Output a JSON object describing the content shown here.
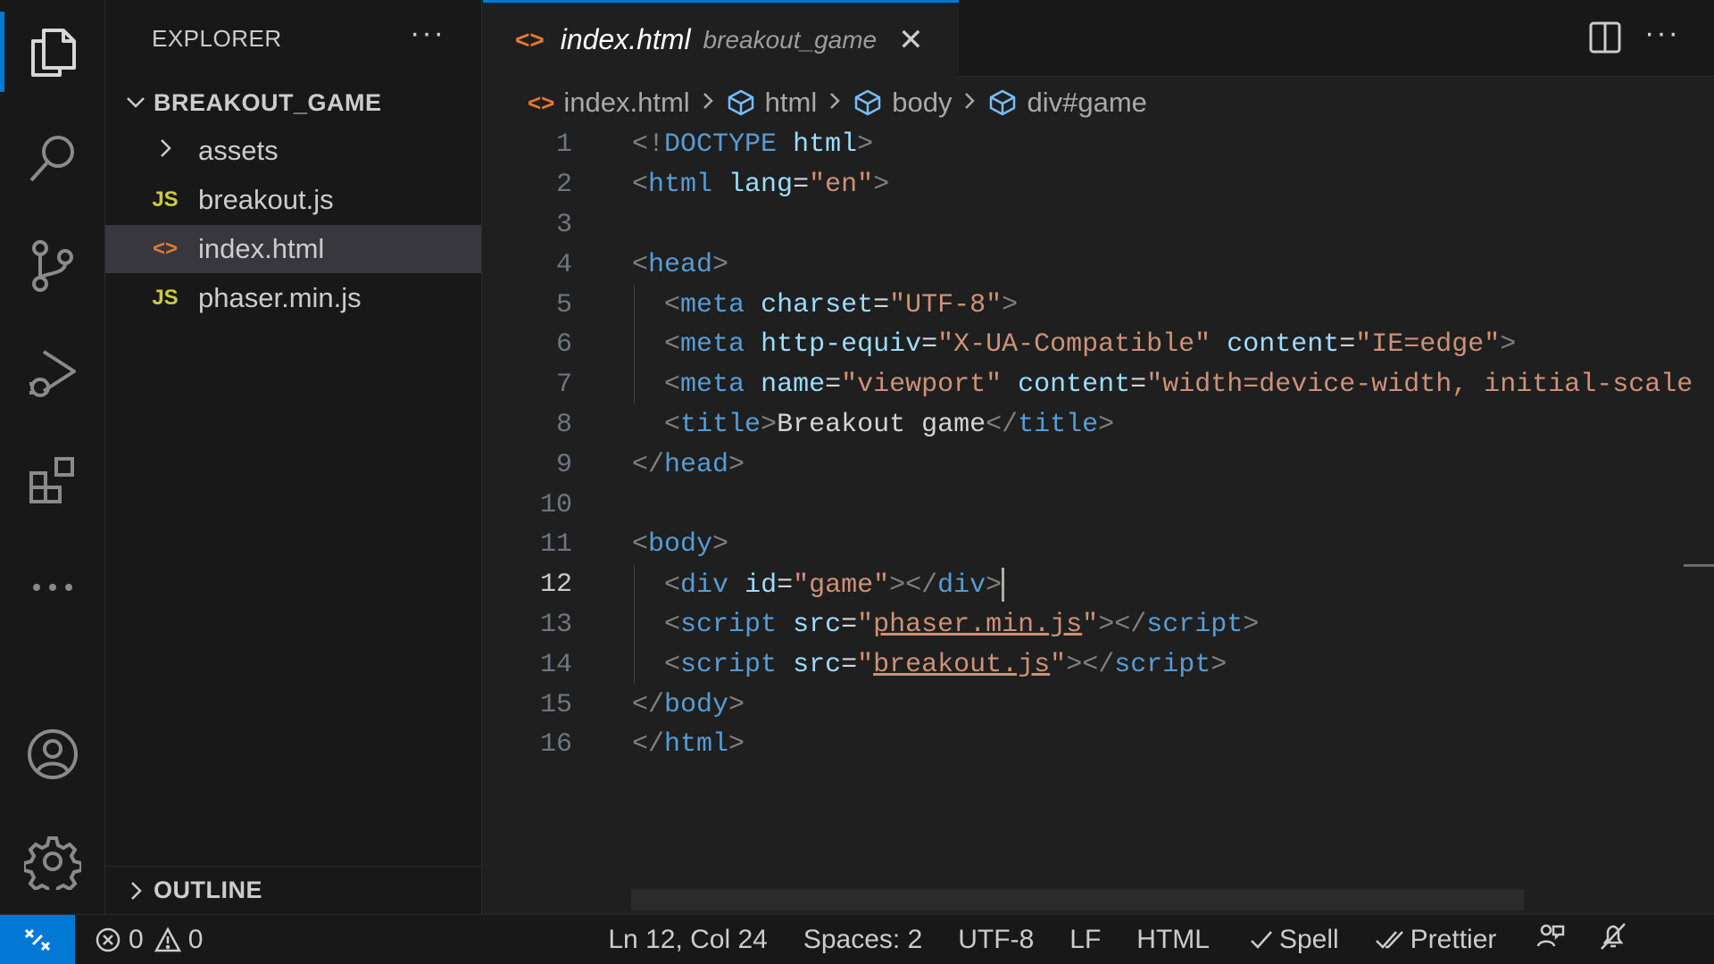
{
  "activity_bar": {
    "items": [
      {
        "name": "explorer-icon",
        "active": true
      },
      {
        "name": "search-icon"
      },
      {
        "name": "source-control-icon"
      },
      {
        "name": "run-debug-icon"
      },
      {
        "name": "extensions-icon"
      },
      {
        "name": "more-icon"
      },
      {
        "name": "accounts-icon"
      },
      {
        "name": "manage-gear-icon"
      }
    ],
    "accent": "#0078d4"
  },
  "sidebar": {
    "title": "EXPLORER",
    "more": "···",
    "folder": "BREAKOUT_GAME",
    "items": [
      {
        "label": "assets",
        "type": "folder",
        "icon": "chevron-right-icon"
      },
      {
        "label": "breakout.js",
        "type": "js",
        "icon_text": "JS"
      },
      {
        "label": "index.html",
        "type": "html",
        "icon_text": "<>",
        "selected": true
      },
      {
        "label": "phaser.min.js",
        "type": "js",
        "icon_text": "JS"
      }
    ],
    "outline": "OUTLINE"
  },
  "tab": {
    "icon_text": "<>",
    "name": "index.html",
    "description": "breakout_game",
    "close": "✕"
  },
  "editor_actions": {
    "more": "···"
  },
  "breadcrumb": {
    "items": [
      "index.html",
      "html",
      "body",
      "div#game"
    ]
  },
  "code": {
    "current_line": 12,
    "line_numbers": [
      "1",
      "2",
      "3",
      "4",
      "5",
      "6",
      "7",
      "8",
      "9",
      "10",
      "11",
      "12",
      "13",
      "14",
      "15",
      "16"
    ]
  },
  "statusbar": {
    "errors": "0",
    "warnings": "0",
    "position": "Ln 12, Col 24",
    "spaces": "Spaces: 2",
    "encoding": "UTF-8",
    "eol": "LF",
    "language": "HTML",
    "spell": "Spell",
    "prettier": "Prettier"
  }
}
